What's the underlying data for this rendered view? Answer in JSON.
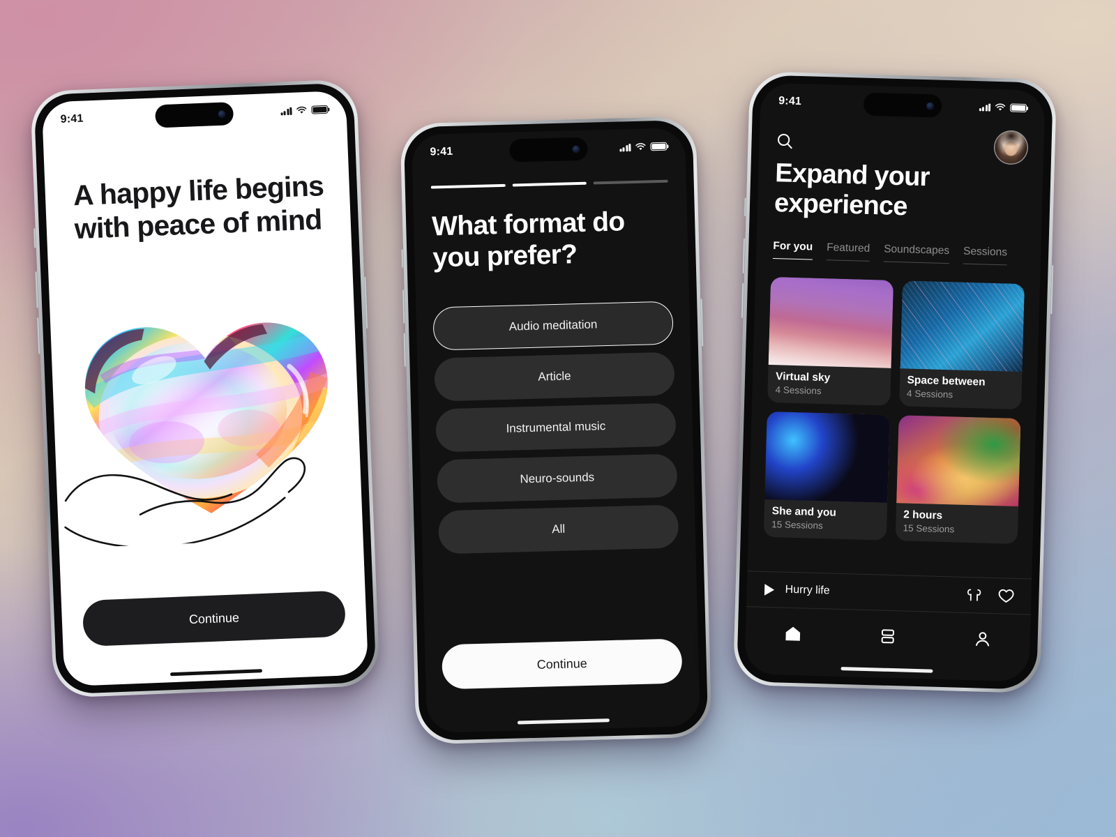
{
  "background": {
    "colors": [
      "#cf90a5",
      "#e3d3c0",
      "#9a83c2",
      "#9cb9d5"
    ]
  },
  "phone1": {
    "status": {
      "time": "9:41",
      "signal_icon": "cellular-signal-icon",
      "wifi_icon": "wifi-icon",
      "battery_icon": "battery-icon"
    },
    "headline": "A happy life begins with peace of mind",
    "illustration": "iridescent-heart-in-hand-illustration",
    "cta_label": "Continue"
  },
  "phone2": {
    "status": {
      "time": "9:41",
      "signal_icon": "cellular-signal-icon",
      "wifi_icon": "wifi-icon",
      "battery_icon": "battery-icon"
    },
    "progress": {
      "total": 3,
      "completed": 2
    },
    "headline": "What format do you prefer?",
    "options": [
      {
        "label": "Audio meditation",
        "selected": true
      },
      {
        "label": "Article",
        "selected": false
      },
      {
        "label": "Instrumental music",
        "selected": false
      },
      {
        "label": "Neuro-sounds",
        "selected": false
      },
      {
        "label": "All",
        "selected": false
      }
    ],
    "cta_label": "Continue"
  },
  "phone3": {
    "status": {
      "time": "9:41",
      "signal_icon": "cellular-signal-icon",
      "wifi_icon": "wifi-icon",
      "battery_icon": "battery-icon"
    },
    "search_icon": "search-icon",
    "avatar": "user-avatar-photo",
    "title": "Expand your experience",
    "tabs": [
      {
        "label": "For you",
        "active": true
      },
      {
        "label": "Featured",
        "active": false
      },
      {
        "label": "Soundscapes",
        "active": false
      },
      {
        "label": "Sessions",
        "active": false
      }
    ],
    "cards": [
      {
        "title": "Virtual sky",
        "subtitle": "4 Sessions",
        "thumb": "purple-sky-clouds"
      },
      {
        "title": "Space between",
        "subtitle": "4 Sessions",
        "thumb": "blue-light-streaks"
      },
      {
        "title": "She and you",
        "subtitle": "15 Sessions",
        "thumb": "iridescent-liquid-bubbles"
      },
      {
        "title": "2 hours",
        "subtitle": "15 Sessions",
        "thumb": "rainbow-gradient-blur"
      }
    ],
    "player": {
      "play_icon": "play-icon",
      "track_title": "Hurry life",
      "airpods_icon": "airpods-icon",
      "favorite_icon": "heart-icon"
    },
    "nav": [
      {
        "icon": "home-icon",
        "active": true
      },
      {
        "icon": "library-icon",
        "active": false
      },
      {
        "icon": "profile-icon",
        "active": false
      }
    ]
  }
}
